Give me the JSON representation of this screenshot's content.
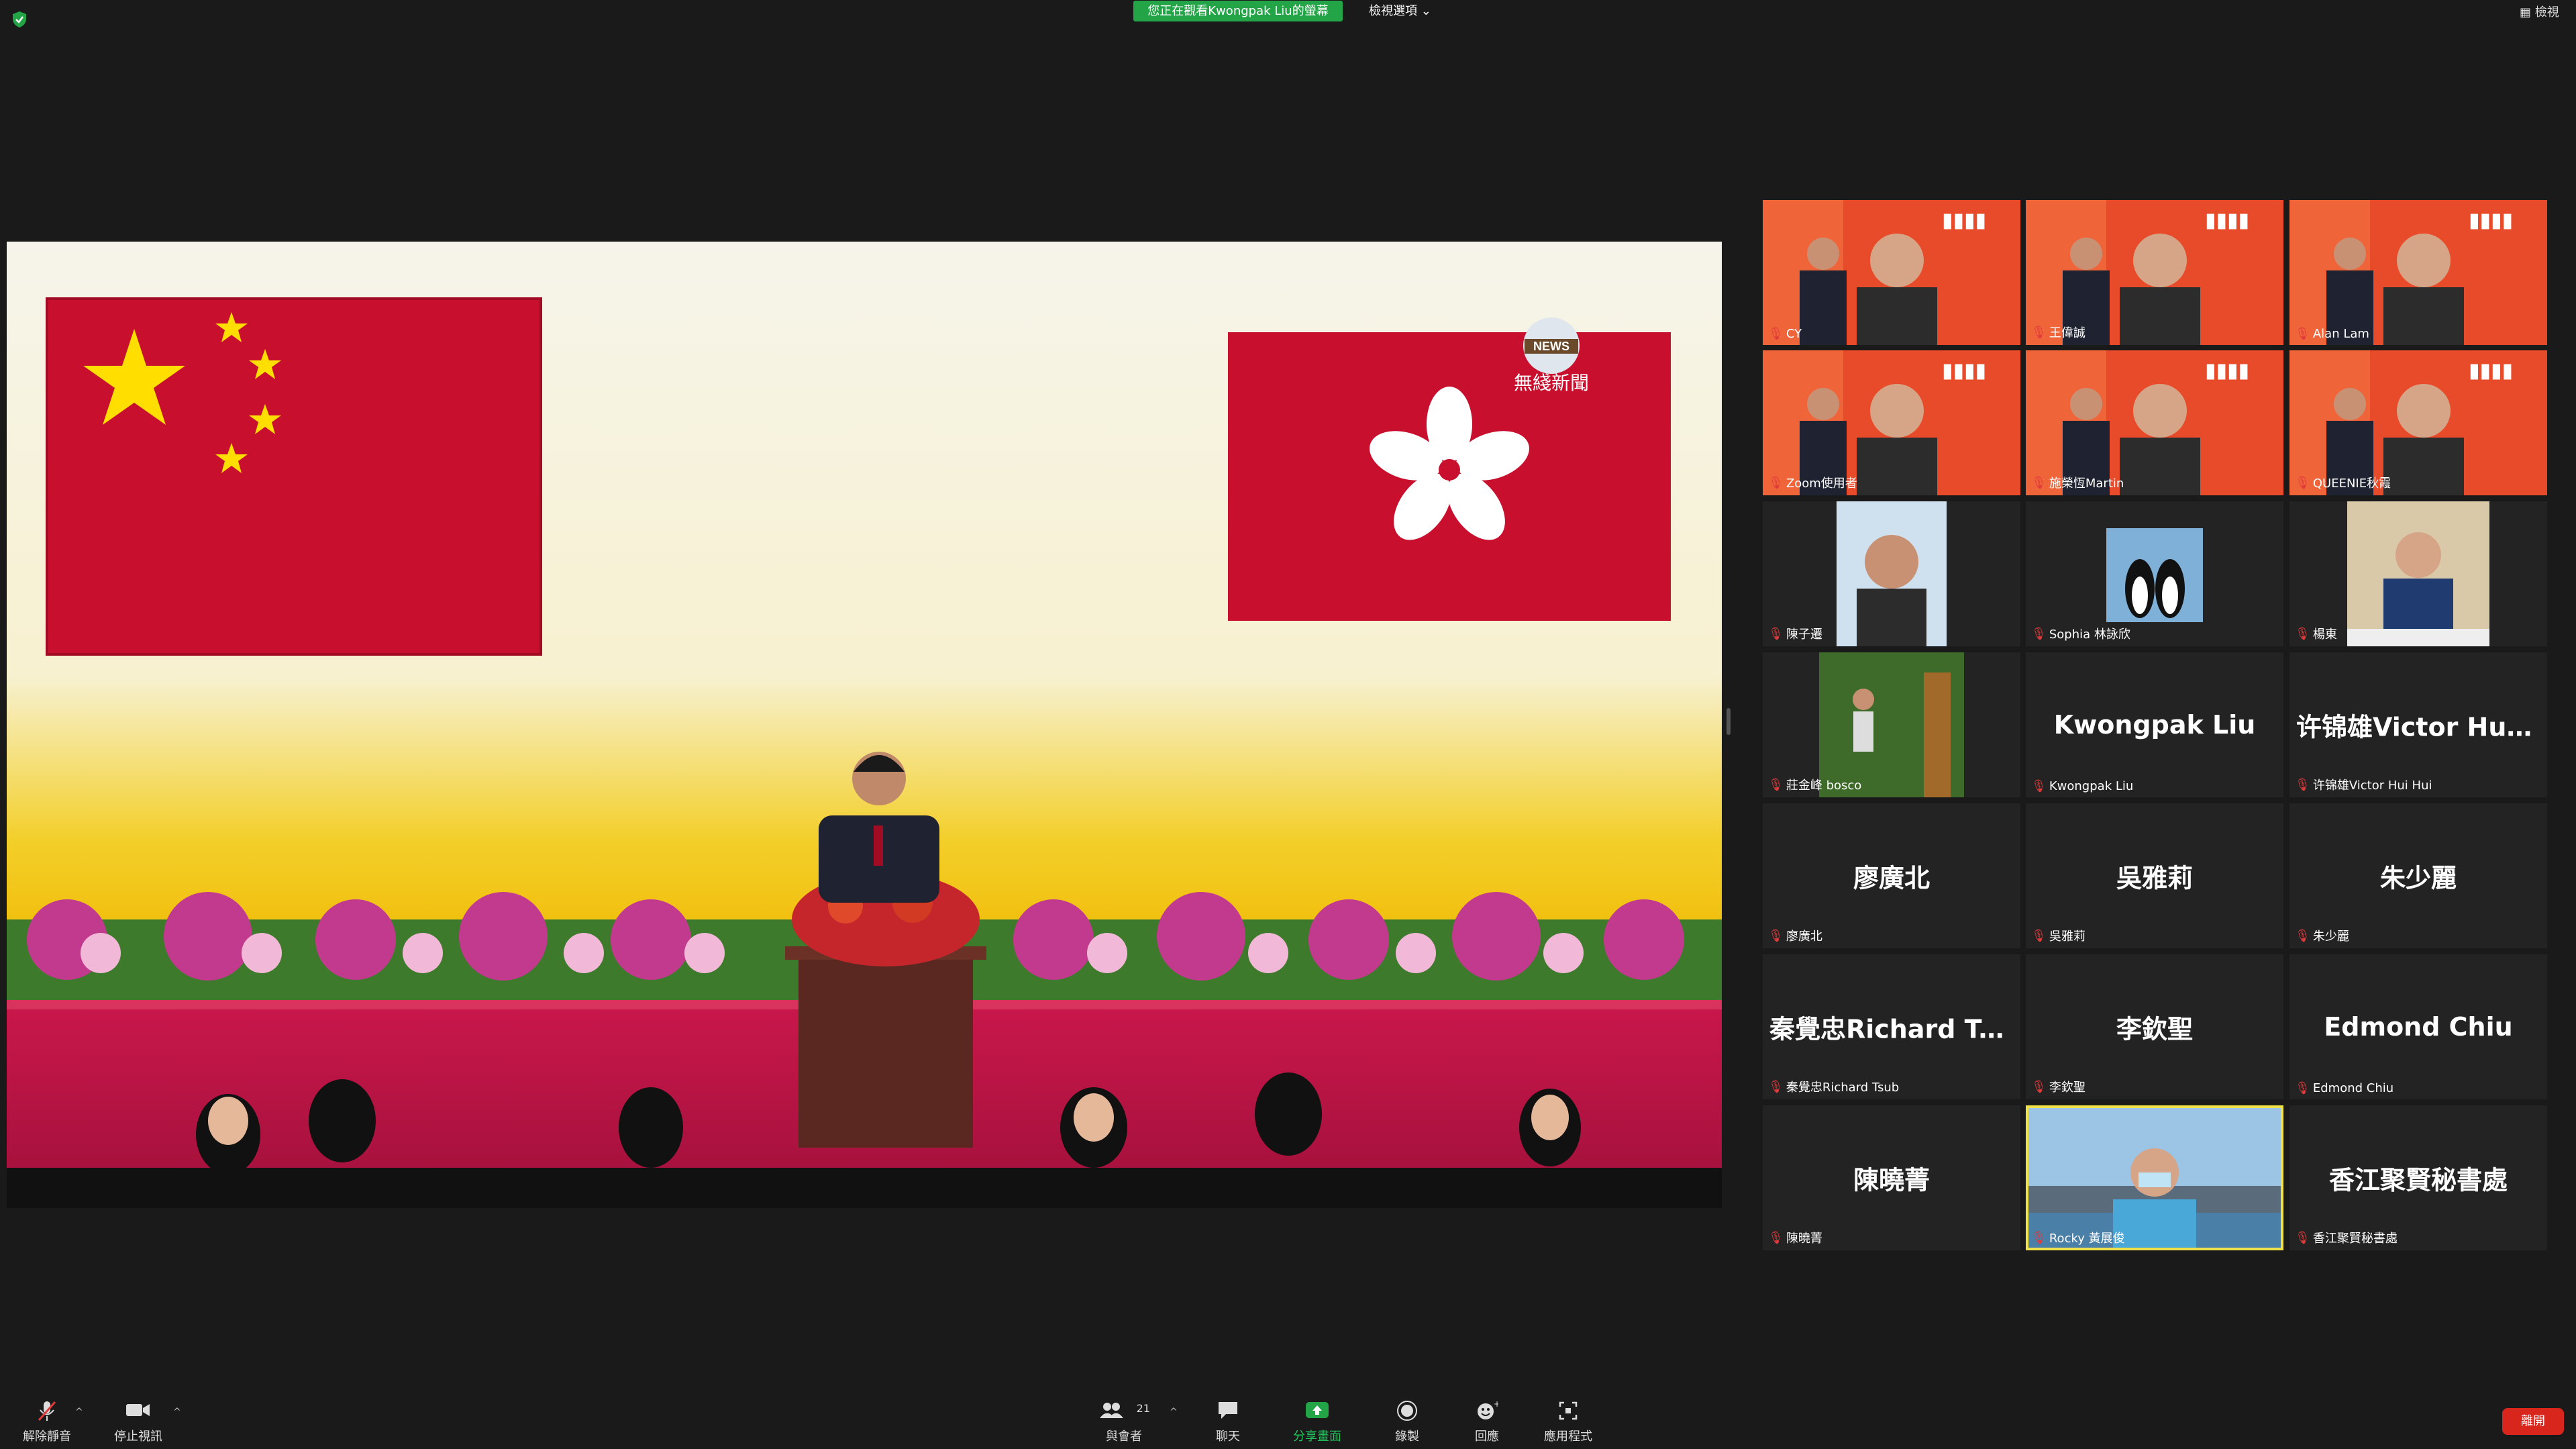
{
  "header": {
    "share_banner": "您正在觀看Kwongpak Liu的螢幕",
    "view_options": "檢視選項 ⌄",
    "view_button": "檢視"
  },
  "shared_screen": {
    "logo_text": "NEWS",
    "channel_text": "無綫新聞"
  },
  "participants": [
    {
      "label": "CY",
      "display": "",
      "video": true,
      "scene": "banner"
    },
    {
      "label": "王偉誠",
      "display": "",
      "video": true,
      "scene": "banner"
    },
    {
      "label": "Alan Lam",
      "display": "",
      "video": true,
      "scene": "banner"
    },
    {
      "label": "Zoom使用者",
      "display": "",
      "video": true,
      "scene": "banner"
    },
    {
      "label": "施榮恆Martin",
      "display": "",
      "video": true,
      "scene": "banner"
    },
    {
      "label": "QUEENIE秋霞",
      "display": "",
      "video": true,
      "scene": "banner"
    },
    {
      "label": "陳子遷",
      "display": "",
      "video": true,
      "scene": "portrait"
    },
    {
      "label": "Sophia 林詠欣",
      "display": "",
      "video": true,
      "scene": "penguins"
    },
    {
      "label": "楊東",
      "display": "",
      "video": true,
      "scene": "office"
    },
    {
      "label": "莊金峰 bosco",
      "display": "",
      "video": true,
      "scene": "forest"
    },
    {
      "label": "Kwongpak Liu",
      "display": "Kwongpak Liu",
      "video": false
    },
    {
      "label": "许锦雄Victor Hui Hui",
      "display": "许锦雄Victor Hui...",
      "video": false
    },
    {
      "label": "廖廣北",
      "display": "廖廣北",
      "video": false
    },
    {
      "label": "吳雅莉",
      "display": "吳雅莉",
      "video": false
    },
    {
      "label": "朱少麗",
      "display": "朱少麗",
      "video": false
    },
    {
      "label": "秦覺忠Richard Tsub",
      "display": "秦覺忠Richard Ts...",
      "video": false
    },
    {
      "label": "李欽聖",
      "display": "李欽聖",
      "video": false
    },
    {
      "label": "Edmond Chiu",
      "display": "Edmond Chiu",
      "video": false
    },
    {
      "label": "陳曉菁",
      "display": "陳曉菁",
      "video": false
    },
    {
      "label": "Rocky 黃展俊",
      "display": "",
      "video": true,
      "scene": "harbour",
      "active": true
    },
    {
      "label": "香江聚賢秘書處",
      "display": "香江聚賢秘書處",
      "video": false
    }
  ],
  "toolbar": {
    "unmute": "解除靜音",
    "stop_video": "停止視訊",
    "participants": "與會者",
    "participant_count": "21",
    "chat": "聊天",
    "share_screen": "分享畫面",
    "record": "錄製",
    "reactions": "回應",
    "apps": "應用程式",
    "leave": "離開"
  },
  "colors": {
    "share_green": "#22a447",
    "leave_red": "#d9261c",
    "active_border": "#f0e14a",
    "background": "#1a1a1a"
  }
}
